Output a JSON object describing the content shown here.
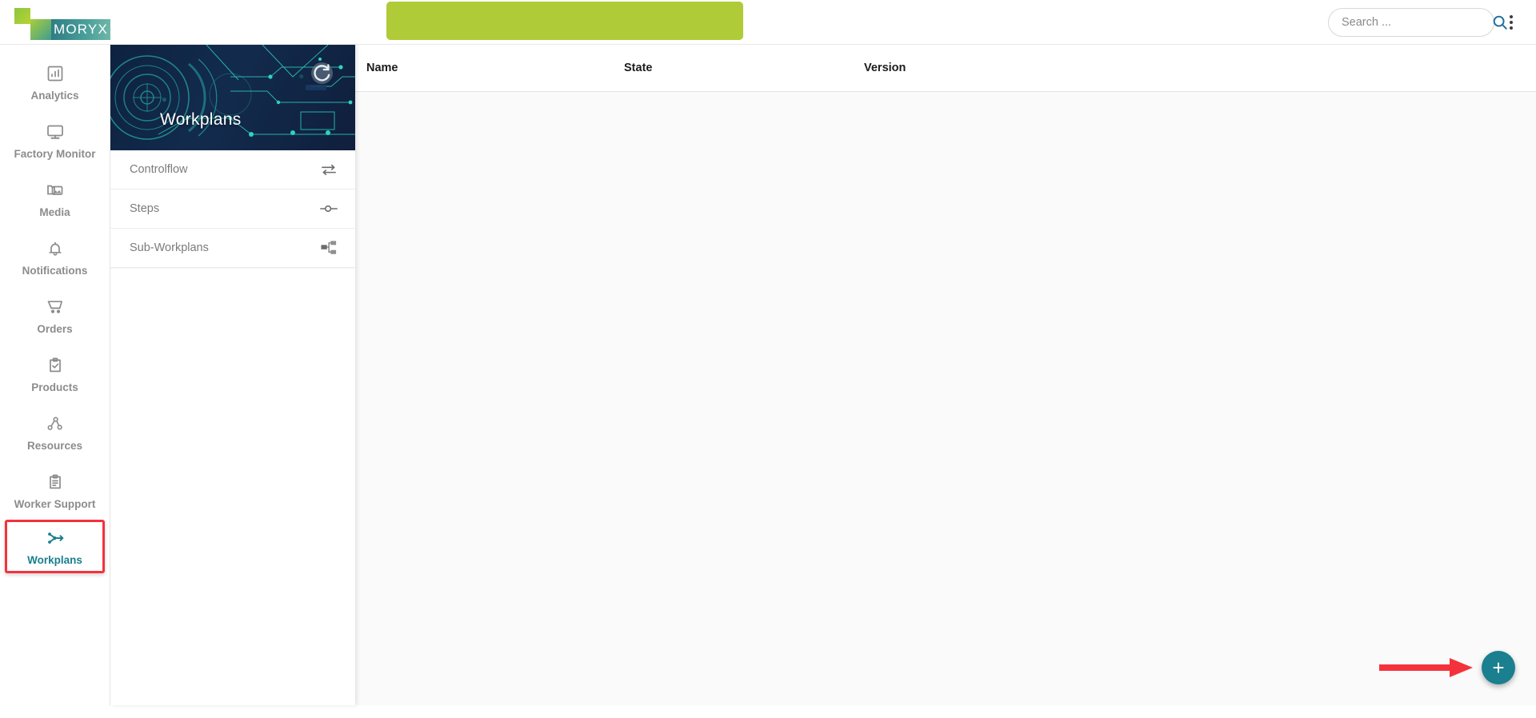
{
  "app": {
    "logo_text": "MORYX",
    "accent_teal": "#1a7f8e",
    "accent_green": "#afcb37",
    "highlight_red": "#f4323c"
  },
  "topbar": {
    "search": {
      "value": "",
      "placeholder": "Search ..."
    },
    "search_icon": "search-icon",
    "overflow_icon": "kebab-menu-icon",
    "green_banner_label": ""
  },
  "sidebar": {
    "items": [
      {
        "label": "Analytics",
        "icon": "chart-bar-icon",
        "active": false
      },
      {
        "label": "Factory Monitor",
        "icon": "monitor-icon",
        "active": false
      },
      {
        "label": "Media",
        "icon": "media-folder-icon",
        "active": false
      },
      {
        "label": "Notifications",
        "icon": "bell-icon",
        "active": false
      },
      {
        "label": "Orders",
        "icon": "cart-icon",
        "active": false
      },
      {
        "label": "Products",
        "icon": "clipboard-check-icon",
        "active": false
      },
      {
        "label": "Resources",
        "icon": "nodes-gear-icon",
        "active": false
      },
      {
        "label": "Worker Support",
        "icon": "clipboard-list-icon",
        "active": false
      },
      {
        "label": "Workplans",
        "icon": "workflow-icon",
        "active": true
      }
    ]
  },
  "panel": {
    "title": "Workplans",
    "refresh_icon": "refresh-icon",
    "items": [
      {
        "label": "Controlflow",
        "icon": "exchange-arrows-icon"
      },
      {
        "label": "Steps",
        "icon": "step-node-icon"
      },
      {
        "label": "Sub-Workplans",
        "icon": "sitemap-icon"
      }
    ]
  },
  "table": {
    "columns": [
      "Name",
      "State",
      "Version"
    ],
    "rows": []
  },
  "fab": {
    "label": "+",
    "icon": "plus-icon"
  },
  "annotation": {
    "arrow_icon": "red-arrow-pointer",
    "color": "#f4323c"
  }
}
